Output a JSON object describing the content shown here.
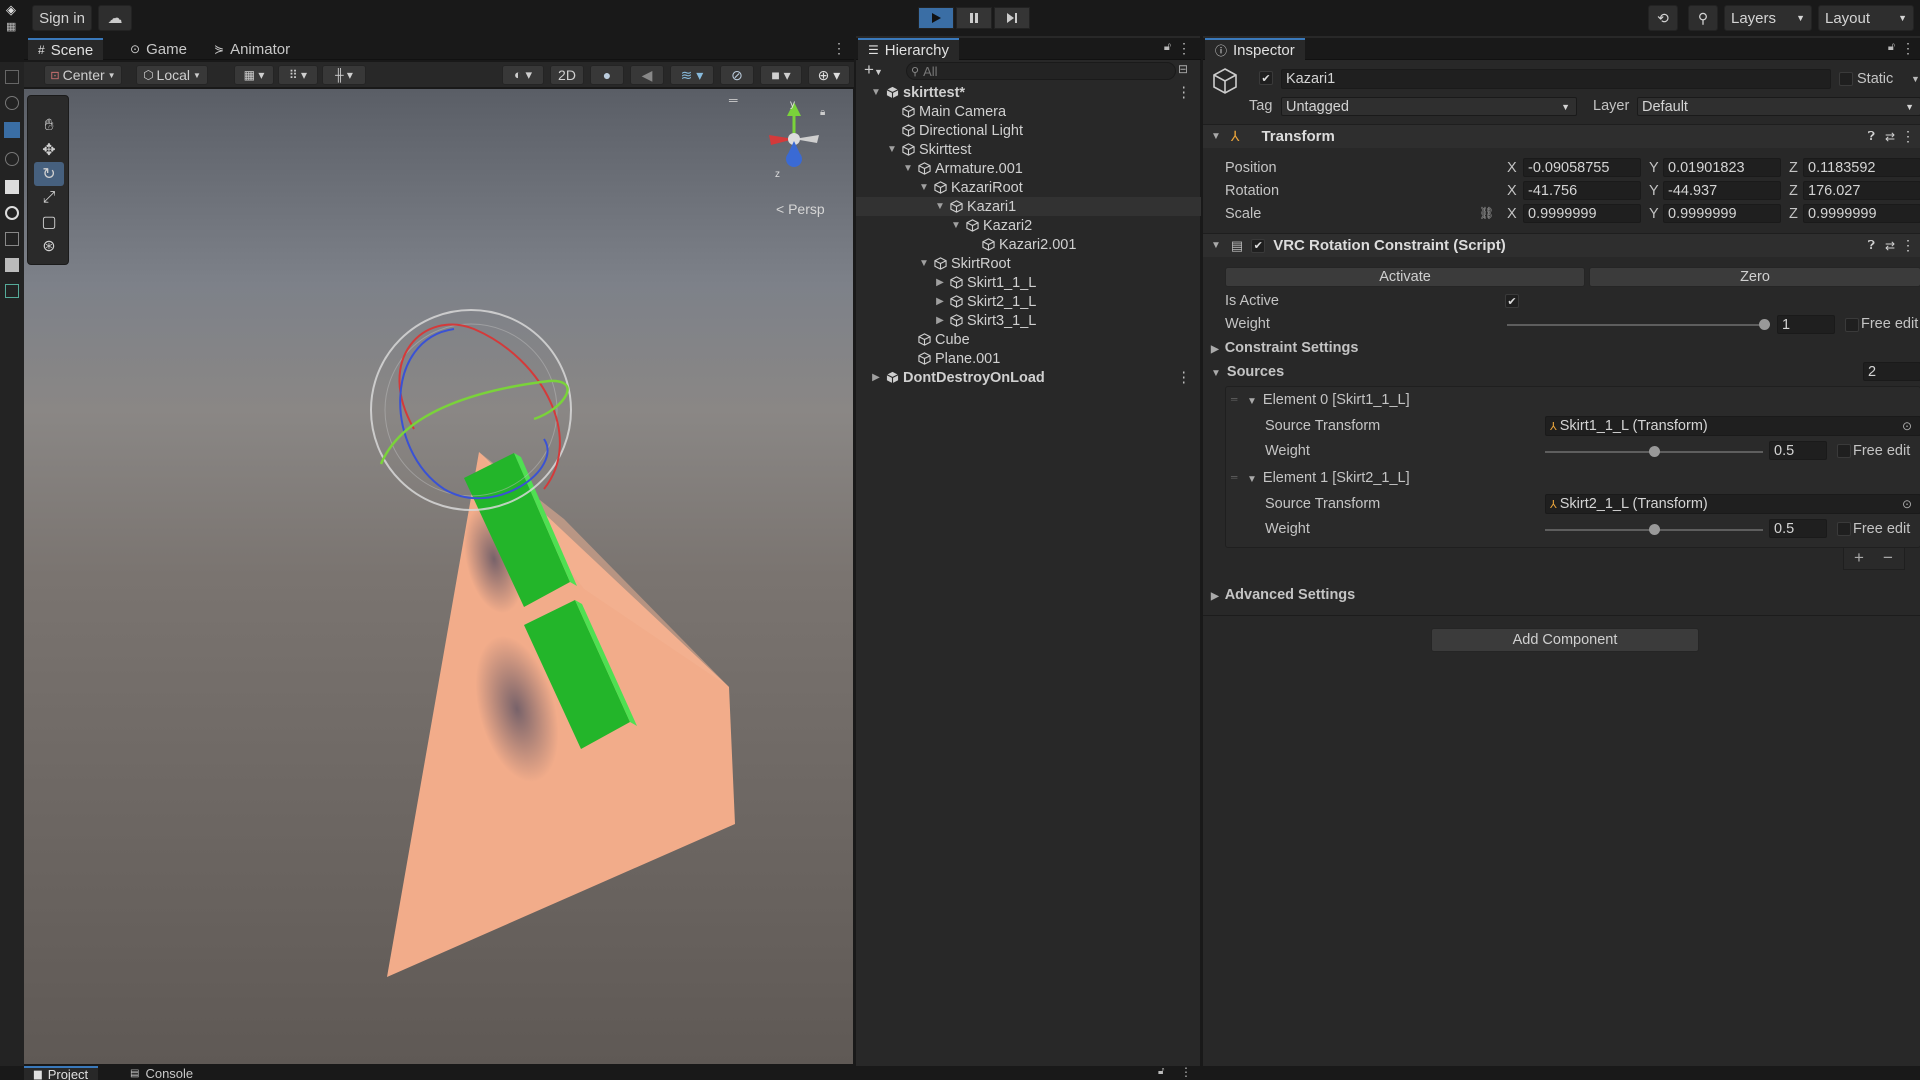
{
  "topbar": {
    "sign_in": "Sign in",
    "layers": "Layers",
    "layout": "Layout"
  },
  "scene_tabs": [
    {
      "label": "Scene"
    },
    {
      "label": "Game"
    },
    {
      "label": "Animator"
    }
  ],
  "scene_toolbar": {
    "pivot": "Center",
    "space": "Local",
    "mode_2d": "2D"
  },
  "viewport": {
    "persp_label": "< Persp",
    "axis_y": "y",
    "axis_z": "z"
  },
  "hierarchy": {
    "title": "Hierarchy",
    "search_placeholder": "All",
    "items": [
      {
        "label": "skirttest*",
        "depth": 0,
        "expanded": true,
        "scene": true
      },
      {
        "label": "Main Camera",
        "depth": 1
      },
      {
        "label": "Directional Light",
        "depth": 1
      },
      {
        "label": "Skirttest",
        "depth": 1,
        "expanded": true
      },
      {
        "label": "Armature.001",
        "depth": 2,
        "expanded": true
      },
      {
        "label": "KazariRoot",
        "depth": 3,
        "expanded": true
      },
      {
        "label": "Kazari1",
        "depth": 4,
        "expanded": true,
        "selected": true
      },
      {
        "label": "Kazari2",
        "depth": 5,
        "expanded": true
      },
      {
        "label": "Kazari2.001",
        "depth": 6
      },
      {
        "label": "SkirtRoot",
        "depth": 3,
        "expanded": true
      },
      {
        "label": "Skirt1_1_L",
        "depth": 4,
        "collapsed": true
      },
      {
        "label": "Skirt2_1_L",
        "depth": 4,
        "collapsed": true
      },
      {
        "label": "Skirt3_1_L",
        "depth": 4,
        "collapsed": true
      },
      {
        "label": "Cube",
        "depth": 2
      },
      {
        "label": "Plane.001",
        "depth": 2
      },
      {
        "label": "DontDestroyOnLoad",
        "depth": 0,
        "collapsed": true,
        "scene": true
      }
    ]
  },
  "inspector": {
    "title": "Inspector",
    "object_name": "Kazari1",
    "static_label": "Static",
    "tag_label": "Tag",
    "tag_value": "Untagged",
    "layer_label": "Layer",
    "layer_value": "Default",
    "transform": {
      "title": "Transform",
      "position_label": "Position",
      "rotation_label": "Rotation",
      "scale_label": "Scale",
      "position": {
        "x": "-0.09058755",
        "y": "0.01901823",
        "z": "0.1183592"
      },
      "rotation": {
        "x": "-41.756",
        "y": "-44.937",
        "z": "176.027"
      },
      "scale": {
        "x": "0.9999999",
        "y": "0.9999999",
        "z": "0.9999999"
      },
      "x": "X",
      "y": "Y",
      "z": "Z"
    },
    "constraint": {
      "title": "VRC Rotation Constraint (Script)",
      "activate": "Activate",
      "zero": "Zero",
      "is_active_label": "Is Active",
      "weight_label": "Weight",
      "weight_value": "1",
      "free_edit": "Free edit",
      "constraint_settings": "Constraint Settings",
      "sources_label": "Sources",
      "sources_count": "2",
      "elements": [
        {
          "title": "Element 0 [Skirt1_1_L]",
          "source_label": "Source Transform",
          "source_value": "Skirt1_1_L (Transform)",
          "weight_label": "Weight",
          "weight_value": "0.5",
          "free_edit": "Free edit"
        },
        {
          "title": "Element 1 [Skirt2_1_L]",
          "source_label": "Source Transform",
          "source_value": "Skirt2_1_L (Transform)",
          "weight_label": "Weight",
          "weight_value": "0.5",
          "free_edit": "Free edit"
        }
      ],
      "add": "+",
      "remove": "−",
      "advanced_settings": "Advanced Settings"
    },
    "add_component": "Add Component"
  },
  "bottom_tabs": [
    {
      "label": "Project"
    },
    {
      "label": "Console"
    }
  ],
  "colors": {
    "accent": "#3a79bb",
    "selection": "#46607e",
    "plane": "#f2ac8a",
    "box": "#22c32a"
  }
}
